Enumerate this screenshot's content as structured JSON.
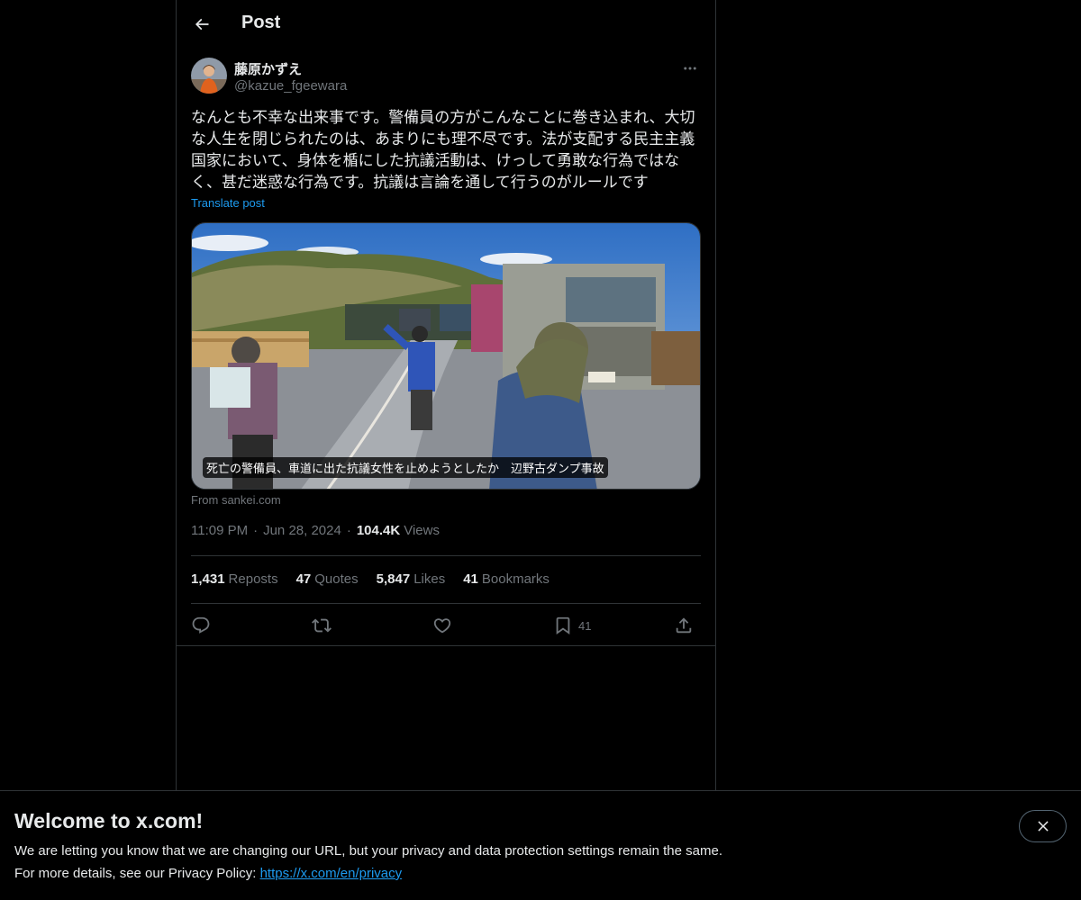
{
  "header": {
    "back_icon": "arrow-left-icon",
    "title": "Post"
  },
  "author": {
    "display_name": "藤原かずえ",
    "handle": "@kazue_fgeewara",
    "more_icon": "more-horizontal-icon"
  },
  "post": {
    "text": "なんとも不幸な出来事です。警備員の方がこんなことに巻き込まれ、大切\nな人生を閉じられたのは、あまりにも理不尽です。法が支配する民主主義\n国家において、身体を楯にした抗議活動は、けっして勇敢な行為ではな\nく、甚だ迷惑な行為です。抗議は言論を通して行うのがルールです",
    "translate_label": "Translate post"
  },
  "card": {
    "caption": "死亡の警備員、車道に出た抗議女性を止めようとしたか　辺野古ダンプ事故",
    "source": "From sankei.com"
  },
  "meta": {
    "time": "11:09 PM",
    "date": "Jun 28, 2024",
    "separator": "·",
    "views_count": "104.4K",
    "views_label": "Views"
  },
  "stats": {
    "reposts_count": "1,431",
    "reposts_label": "Reposts",
    "quotes_count": "47",
    "quotes_label": "Quotes",
    "likes_count": "5,847",
    "likes_label": "Likes",
    "bookmarks_count": "41",
    "bookmarks_label": "Bookmarks"
  },
  "actions": {
    "reply_icon": "reply-icon",
    "repost_icon": "repost-icon",
    "like_icon": "heart-icon",
    "bookmark_icon": "bookmark-icon",
    "bookmark_count": "41",
    "share_icon": "share-icon"
  },
  "banner": {
    "title": "Welcome to x.com!",
    "line1": "We are letting you know that we are changing our URL, but your privacy and data protection settings remain the same.",
    "line2_prefix": "For more details, see our Privacy Policy: ",
    "link_text": "https://x.com/en/privacy",
    "close_icon": "close-icon"
  },
  "colors": {
    "background": "#000000",
    "text": "#e7e9ea",
    "secondary_text": "#71767b",
    "accent": "#1d9bf0",
    "border": "#2f3336"
  }
}
